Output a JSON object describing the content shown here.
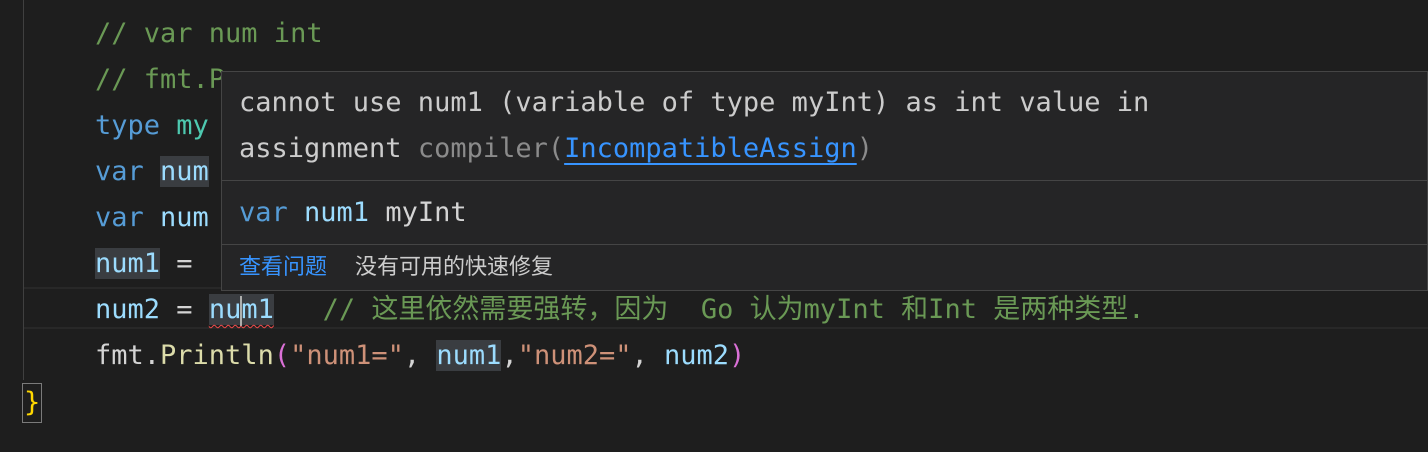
{
  "code": {
    "line1": "// var num int",
    "line2_prefix": "// fmt.Pr",
    "line3_kw": "type",
    "line3_rest": " my",
    "line4_kw": "var",
    "line4_rest": "num",
    "line5_kw": "var",
    "line5_rest": " num",
    "line6_var": "num1",
    "line6_op": " = ",
    "line7_lhs": "num2",
    "line7_op": " = ",
    "line7_rhs_a": "nu",
    "line7_rhs_b": "m1",
    "line7_comment": "   // 这里依然需要强转，因为  Go 认为myInt 和Int 是两种类型.",
    "line8_pkg": "fmt.",
    "line8_fn": "Println",
    "line8_open": "(",
    "line8_str1": "\"num1=\"",
    "line8_sep1": ", ",
    "line8_arg1": "num1",
    "line8_sep2": ",",
    "line8_str2": "\"num2=\"",
    "line8_sep3": ", ",
    "line8_arg2": "num2",
    "line8_close": ")",
    "line9": "}"
  },
  "hover": {
    "message_line1": "cannot use num1 (variable of type myInt) as int value in",
    "message_line2": "assignment",
    "source_prefix": " compiler(",
    "error_code": "IncompatibleAssign",
    "source_suffix": ")",
    "sig_kw": "var",
    "sig_name": " num1",
    "sig_type": " myInt",
    "view_problem": "查看问题",
    "no_quick_fix": "没有可用的快速修复"
  },
  "colors": {
    "background": "#1e1e1e",
    "keyword": "#569cd6",
    "comment": "#6a9955",
    "string": "#ce9178",
    "function": "#dcdcaa",
    "variable": "#9cdcfe",
    "link": "#3794ff",
    "error": "#f14c4c"
  }
}
